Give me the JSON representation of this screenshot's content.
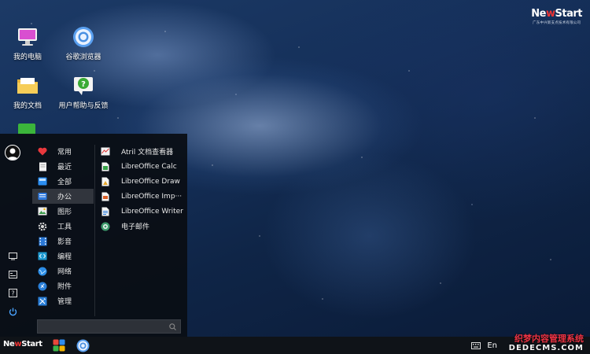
{
  "brand": {
    "name_prefix": "Ne",
    "name_w": "w",
    "name_suffix": "Start",
    "subtitle": "广东中兴新支点技术有限公司"
  },
  "desktop_icons": [
    {
      "label": "我的电脑",
      "icon": "computer-icon"
    },
    {
      "label": "谷歌浏览器",
      "icon": "chrome-icon"
    },
    {
      "label": "我的文档",
      "icon": "folder-icon"
    },
    {
      "label": "用户帮助与反馈",
      "icon": "help-feedback-icon"
    }
  ],
  "start_menu": {
    "categories": [
      {
        "label": "常用",
        "icon": "heart-icon"
      },
      {
        "label": "最近",
        "icon": "recent-document-icon"
      },
      {
        "label": "全部",
        "icon": "all-apps-icon"
      },
      {
        "label": "办公",
        "icon": "office-icon",
        "active": true
      },
      {
        "label": "图形",
        "icon": "image-icon"
      },
      {
        "label": "工具",
        "icon": "gear-icon"
      },
      {
        "label": "影音",
        "icon": "film-icon"
      },
      {
        "label": "编程",
        "icon": "code-icon"
      },
      {
        "label": "网络",
        "icon": "globe-icon"
      },
      {
        "label": "附件",
        "icon": "attachment-icon"
      },
      {
        "label": "管理",
        "icon": "tools-icon"
      }
    ],
    "apps": [
      {
        "label": "Atril 文档查看器",
        "icon": "atril-icon"
      },
      {
        "label": "LibreOffice Calc",
        "icon": "calc-icon"
      },
      {
        "label": "LibreOffice Draw",
        "icon": "draw-icon"
      },
      {
        "label": "LibreOffice Imp···",
        "icon": "impress-icon"
      },
      {
        "label": "LibreOffice Writer",
        "icon": "writer-icon"
      },
      {
        "label": "电子邮件",
        "icon": "email-icon"
      }
    ],
    "search": {
      "placeholder": "",
      "value": ""
    }
  },
  "taskbar": {
    "logo_prefix": "Ne",
    "logo_w": "w",
    "logo_suffix": "Start",
    "language": "En"
  },
  "watermark": {
    "line1": "织梦内容管理系统",
    "line2": "DEDECMS.COM"
  },
  "colors": {
    "accent_red": "#e33333",
    "menu_bg": "#0a0e14",
    "taskbar_bg": "#0f1318"
  }
}
